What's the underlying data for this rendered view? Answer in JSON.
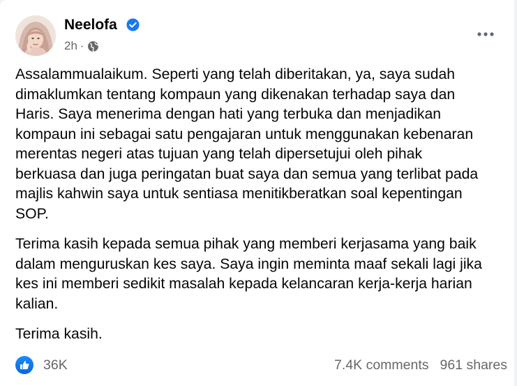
{
  "post": {
    "author": {
      "name": "Neelofa",
      "avatar_icon": "profile-photo",
      "verified_icon": "verified-badge-icon",
      "verified_color": "#1877f2"
    },
    "timestamp": "2h",
    "separator": "·",
    "privacy_icon": "globe-icon",
    "more_icon": "more-options-icon",
    "paragraphs": [
      "Assalammualaikum. Seperti yang telah diberitakan, ya, saya sudah\ndimaklumkan tentang kompaun yang dikenakan terhadap saya dan\nHaris. Saya menerima dengan hati yang terbuka dan menjadikan\nkompaun ini sebagai satu pengajaran untuk menggunakan kebenaran\nmerentas negeri atas tujuan yang telah dipersetujui oleh pihak\nberkuasa dan juga peringatan buat saya dan semua yang terlibat pada\nmajlis kahwin saya untuk sentiasa menitikberatkan soal kepentingan\nSOP.",
      "Terima kasih kepada semua pihak yang memberi kerjasama yang baik\ndalam menguruskan kes saya. Saya ingin meminta maaf sekali lagi jika\nkes ini memberi sedikit masalah kepada kelancaran kerja-kerja harian\nkalian.",
      "Terima kasih."
    ],
    "reactions": {
      "icon": "like-icon",
      "count": "36K",
      "color": "#1877f2"
    },
    "comments": "7.4K comments",
    "shares": "961 shares"
  }
}
